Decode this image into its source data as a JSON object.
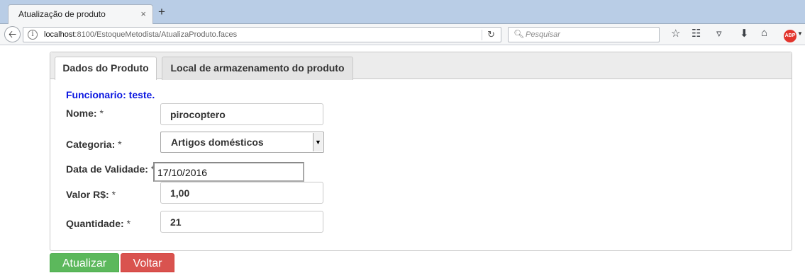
{
  "browser": {
    "tab_title": "Atualização de produto",
    "tab_close": "×",
    "new_tab": "+",
    "url_host": "localhost",
    "url_rest": ":8100/EstoqueMetodista/AtualizaProduto.faces",
    "search_placeholder": "Pesquisar",
    "toolbar_icons": [
      "bookmark-star-icon",
      "reading-list-icon",
      "pocket-icon",
      "download-icon",
      "home-icon",
      "adblock-plus-icon"
    ],
    "abp_label": "ABP"
  },
  "panel": {
    "tabs": [
      {
        "label": "Dados do Produto",
        "active": true
      },
      {
        "label": "Local de armazenamento do produto",
        "active": false
      }
    ]
  },
  "form": {
    "employee": "Funcionario: teste.",
    "required_mark": "*",
    "name_label": "Nome:",
    "name_value": "pirocoptero",
    "category_label": "Categoria:",
    "category_value": "Artigos domésticos",
    "validity_label": "Data de Validade:",
    "validity_value": "17/10/2016",
    "price_label": "Valor R$:",
    "price_value": "1,00",
    "quantity_label": "Quantidade:",
    "quantity_value": "21"
  },
  "buttons": {
    "update": "Atualizar",
    "back": "Voltar"
  },
  "colors": {
    "update_button": "#5cb85c",
    "back_button": "#d9534f",
    "employee_text": "#0a16e0"
  }
}
